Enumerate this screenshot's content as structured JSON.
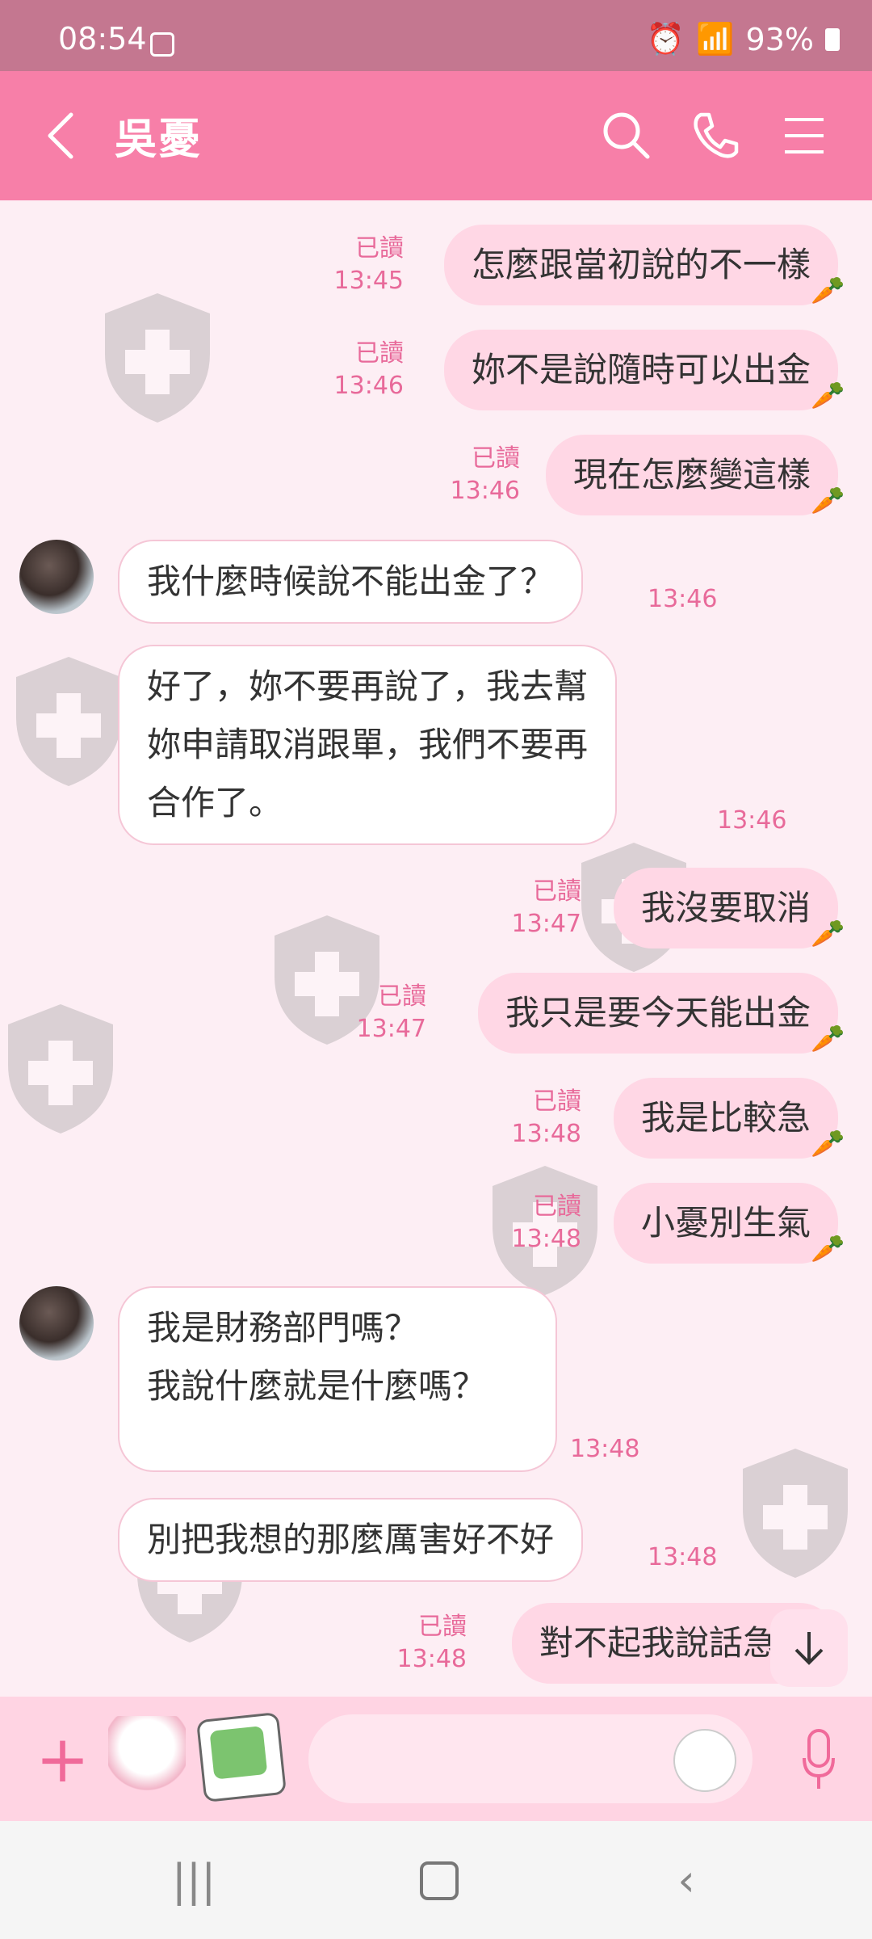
{
  "status_bar": {
    "time": "08:54",
    "battery": "93%"
  },
  "header": {
    "title": "吳憂"
  },
  "messages": [
    {
      "from": "me",
      "text": "怎麼跟當初說的不一樣",
      "read": "已讀",
      "time": "13:45"
    },
    {
      "from": "me",
      "text": "妳不是說隨時可以出金",
      "read": "已讀",
      "time": "13:46"
    },
    {
      "from": "me",
      "text": "現在怎麼變這樣",
      "read": "已讀",
      "time": "13:46"
    },
    {
      "from": "them",
      "text": "我什麼時候說不能出金了？",
      "time": "13:46"
    },
    {
      "from": "them",
      "lines": [
        "好了，妳不要再說了，我去幫",
        "妳申請取消跟單，我們不要再",
        "合作了。"
      ],
      "time": "13:46"
    },
    {
      "from": "me",
      "text": "我沒要取消",
      "read": "已讀",
      "time": "13:47"
    },
    {
      "from": "me",
      "text": "我只是要今天能出金",
      "read": "已讀",
      "time": "13:47"
    },
    {
      "from": "me",
      "text": "我是比較急",
      "read": "已讀",
      "time": "13:48"
    },
    {
      "from": "me",
      "text": "小憂別生氣",
      "read": "已讀",
      "time": "13:48"
    },
    {
      "from": "them",
      "lines": [
        "我是財務部門嗎？",
        "我說什麼就是什麼嗎？"
      ],
      "time": "13:48"
    },
    {
      "from": "them",
      "text": "別把我想的那麼厲害好不好",
      "time": "13:48"
    },
    {
      "from": "me",
      "text": "對不起我說話急了",
      "read": "已讀",
      "time": "13:48"
    }
  ],
  "icons": {
    "back": "chevron-left-icon",
    "search": "search-icon",
    "call": "phone-icon",
    "menu": "menu-icon",
    "plus": "plus-icon",
    "mic": "microphone-icon",
    "emoji": "emoji-icon",
    "scroll_down": "arrow-down-icon"
  },
  "colors": {
    "header": "#f77fa8",
    "status_bar": "#c47790",
    "my_bubble": "#ffd7e5",
    "chat_bg": "#fdeef4",
    "accent": "#e86a9a"
  }
}
